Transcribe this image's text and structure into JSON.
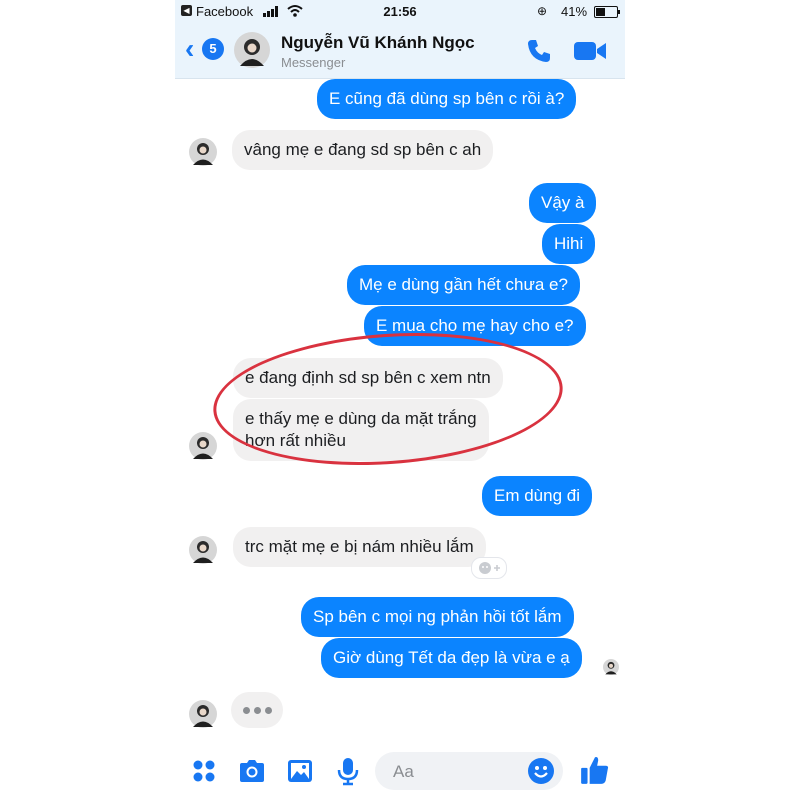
{
  "status_bar": {
    "back_app": "Facebook",
    "time": "21:56",
    "battery": "41%"
  },
  "header": {
    "back_count": "5",
    "name": "Nguyễn Vũ Khánh Ngọc",
    "subtitle": "Messenger"
  },
  "messages": [
    {
      "side": "out",
      "text": "E cũng đã dùng sp bên c rồi à?"
    },
    {
      "side": "in",
      "text": "vâng mẹ e đang sd sp bên c ah"
    },
    {
      "side": "out",
      "text": "Vậy à"
    },
    {
      "side": "out",
      "text": "Hihi"
    },
    {
      "side": "out",
      "text": "Mẹ e dùng gần hết chưa e?"
    },
    {
      "side": "out",
      "text": "E mua cho mẹ hay cho e?"
    },
    {
      "side": "in",
      "text": "e đang định sd sp bên c xem ntn"
    },
    {
      "side": "in",
      "text_lines": [
        "e thấy mẹ e dùng da mặt trắng",
        "hơn rất nhiều"
      ]
    },
    {
      "side": "out",
      "text": "Em dùng đi"
    },
    {
      "side": "in",
      "text": "trc mặt mẹ e bị nám nhiều lắm"
    },
    {
      "side": "out",
      "text": "Sp bên c mọi ng phản hồi tốt lắm"
    },
    {
      "side": "out",
      "text": "Giờ dùng Tết da đẹp là vừa e ạ"
    }
  ],
  "composer": {
    "placeholder": "Aa"
  },
  "colors": {
    "outgoing_bubble": "#0b84ff",
    "incoming_bubble": "#f1f0f0",
    "accent": "#1877f2",
    "highlight_circle": "#d9323f",
    "header_bg": "#eaf4fc"
  },
  "icons": {
    "header": [
      "back-chevron-icon",
      "phone-icon",
      "video-camera-icon"
    ],
    "bottom_bar": [
      "apps-grid-icon",
      "camera-icon",
      "gallery-icon",
      "microphone-icon",
      "emoji-icon",
      "thumbs-up-icon"
    ],
    "status": [
      "signal-icon",
      "wifi-icon",
      "rotation-lock-icon",
      "battery-icon"
    ]
  }
}
